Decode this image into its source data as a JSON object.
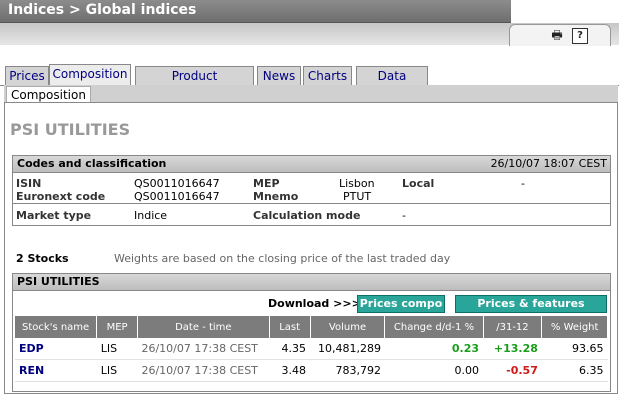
{
  "header": {
    "title": "Indices > Global indices",
    "print_icon": "printer-icon",
    "help_label": "?"
  },
  "tabs": [
    {
      "label": "Prices"
    },
    {
      "label": "Composition"
    },
    {
      "label": "Product information"
    },
    {
      "label": "News"
    },
    {
      "label": "Charts"
    },
    {
      "label": "Data centre"
    }
  ],
  "subtab": {
    "label": "Composition"
  },
  "page_title": "PSI UTILITIES",
  "codes": {
    "heading": "Codes and classification",
    "date": "26/10/07 18:07 CEST",
    "isin_label": "ISIN",
    "isin_value": "QS0011016647",
    "euronext_label": "Euronext code",
    "euronext_value": "QS0011016647",
    "mep_label": "MEP",
    "mep_value": "Lisbon",
    "mnemo_label": "Mnemo",
    "mnemo_value": "PTUT",
    "local_label": "Local",
    "local_value": "-",
    "market_type_label": "Market type",
    "market_type_value": "Indice",
    "calc_mode_label": "Calculation mode",
    "calc_mode_value": "-"
  },
  "stocks": {
    "count": "2 Stocks",
    "note": "Weights are based on the closing price of the last traded day",
    "heading": "PSI UTILITIES",
    "download_label": "Download >>>>",
    "btn_prices": "Prices compo",
    "btn_features": "Prices & features compo",
    "columns": [
      "Stock's name",
      "MEP",
      "Date - time",
      "Last",
      "Volume",
      "Change d/d-1 %",
      "/31-12",
      "% Weight"
    ],
    "rows": [
      {
        "name": "EDP",
        "mep": "LIS",
        "datetime": "26/10/07 17:38 CEST",
        "last": "4.35",
        "volume": "10,481,289",
        "change": "0.23",
        "ytd": "+13.28",
        "weight": "93.65"
      },
      {
        "name": "REN",
        "mep": "LIS",
        "datetime": "26/10/07 17:38 CEST",
        "last": "3.48",
        "volume": "783,792",
        "change": "0.00",
        "ytd": "-0.57",
        "weight": "6.35"
      }
    ]
  },
  "colors": {
    "accent_button": "#2aa59a",
    "positive": "#1a9e1a",
    "negative": "#d01818",
    "link": "#000080"
  }
}
